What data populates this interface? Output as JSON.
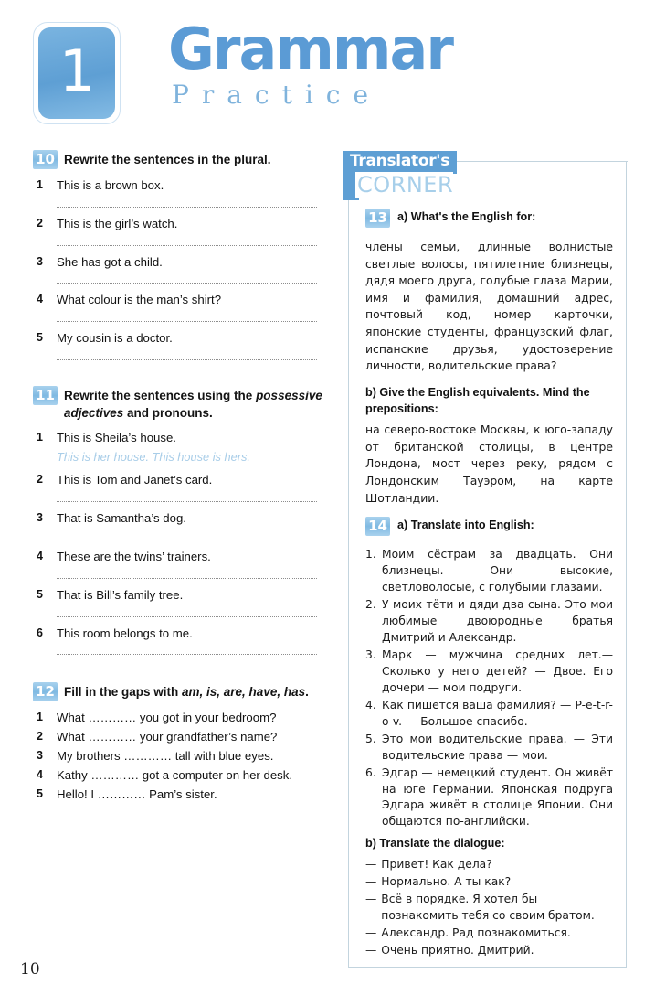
{
  "header": {
    "chapter_number": "1",
    "title_main": "Grammar",
    "title_sub": "Practice",
    "accent_color": "#5b9bd5",
    "badge_color": "#5e9fd4"
  },
  "page_number": "10",
  "left_column": {
    "exercises": [
      {
        "number": "10",
        "prompt": "Rewrite the sentences in the plural.",
        "items": [
          {
            "num": "1",
            "text": "This is a brown box.",
            "answer_line": true
          },
          {
            "num": "2",
            "text": "This is the girl’s watch.",
            "answer_line": true
          },
          {
            "num": "3",
            "text": "She has got a child.",
            "answer_line": true
          },
          {
            "num": "4",
            "text": "What colour is the man’s shirt?",
            "answer_line": true
          },
          {
            "num": "5",
            "text": "My cousin is a doctor.",
            "answer_line": true
          }
        ]
      },
      {
        "number": "11",
        "prompt_part1": "Rewrite the sentences using the ",
        "prompt_italic": "possessive adjectives",
        "prompt_part2": " and pronouns.",
        "items": [
          {
            "num": "1",
            "text": "This is Sheila’s house.",
            "hint": "This is her house. This house is hers.",
            "answer_line": false
          },
          {
            "num": "2",
            "text": "This is Tom and Janet’s card.",
            "answer_line": true
          },
          {
            "num": "3",
            "text": "That is Samantha’s dog.",
            "answer_line": true
          },
          {
            "num": "4",
            "text": "These are the twins’ trainers.",
            "answer_line": true
          },
          {
            "num": "5",
            "text": "That is Bill’s family tree.",
            "answer_line": true
          },
          {
            "num": "6",
            "text": "This room belongs to me.",
            "answer_line": true
          }
        ]
      },
      {
        "number": "12",
        "prompt_part1": "Fill in the gaps with ",
        "prompt_italic": "am, is, are, have, has",
        "prompt_part2": ".",
        "items": [
          {
            "num": "1",
            "text": "What ………… you got in your bedroom?",
            "answer_line": false
          },
          {
            "num": "2",
            "text": "What ………… your grandfather’s name?",
            "answer_line": false
          },
          {
            "num": "3",
            "text": "My brothers ………… tall with blue eyes.",
            "answer_line": false
          },
          {
            "num": "4",
            "text": "Kathy ………… got a computer on her desk.",
            "answer_line": false
          },
          {
            "num": "5",
            "text": "Hello! I ………… Pam’s sister.",
            "answer_line": false
          }
        ]
      }
    ]
  },
  "right_column": {
    "corner_title": "Translator's",
    "corner_subtitle": "CORNER",
    "ex13": {
      "number": "13",
      "prompt_a": "a) What's the English for:",
      "text_a": "члены семьи, длинные волнистые светлые волосы, пятилетние близнецы, дядя моего друга, голубые глаза Марии, имя и фамилия, домашний адрес, почтовый код, номер карточки, японские студенты, французский флаг, испанские друзья, удостоверение личности, водительские права?",
      "prompt_b": "b) Give the English equivalents. Mind the prepositions:",
      "text_b": "на северо-востоке Москвы, к юго-западу от британской столицы, в центре Лондона, мост через реку, рядом с Лондонским Тауэром, на карте Шотландии."
    },
    "ex14": {
      "number": "14",
      "prompt_a": "a) Translate into English:",
      "items_a": [
        {
          "marker": "1.",
          "text": "Моим сёстрам за двадцать. Они близнецы. Они высокие, светловолосые, с голубыми глазами."
        },
        {
          "marker": "2.",
          "text": "У моих тёти и дяди два сына. Это мои любимые двоюродные братья Дмитрий и Александр."
        },
        {
          "marker": "3.",
          "text": "Марк — мужчина средних лет.— Сколько у него детей? — Двое. Его дочери — мои подруги."
        },
        {
          "marker": "4.",
          "text": "Как пишется ваша фамилия? — P-e-t-r-o-v. — Большое спасибо."
        },
        {
          "marker": "5.",
          "text": "Это мои водительские права. — Эти водительские права — мои."
        },
        {
          "marker": "6.",
          "text": "Эдгар — немецкий студент. Он живёт на юге Германии. Японская подруга Эдгара живёт в столице Японии. Они общаются по-английски."
        }
      ],
      "prompt_b": "b) Translate the dialogue:",
      "dialogue": [
        {
          "marker": "—",
          "text": "Привет! Как дела?"
        },
        {
          "marker": "—",
          "text": "Нормально. А ты как?"
        },
        {
          "marker": "—",
          "text": "Всё в порядке. Я хотел бы познакомить тебя со своим братом."
        },
        {
          "marker": "—",
          "text": "Александр. Рад познакомиться."
        },
        {
          "marker": "—",
          "text": "Очень приятно. Дмитрий."
        }
      ]
    }
  }
}
